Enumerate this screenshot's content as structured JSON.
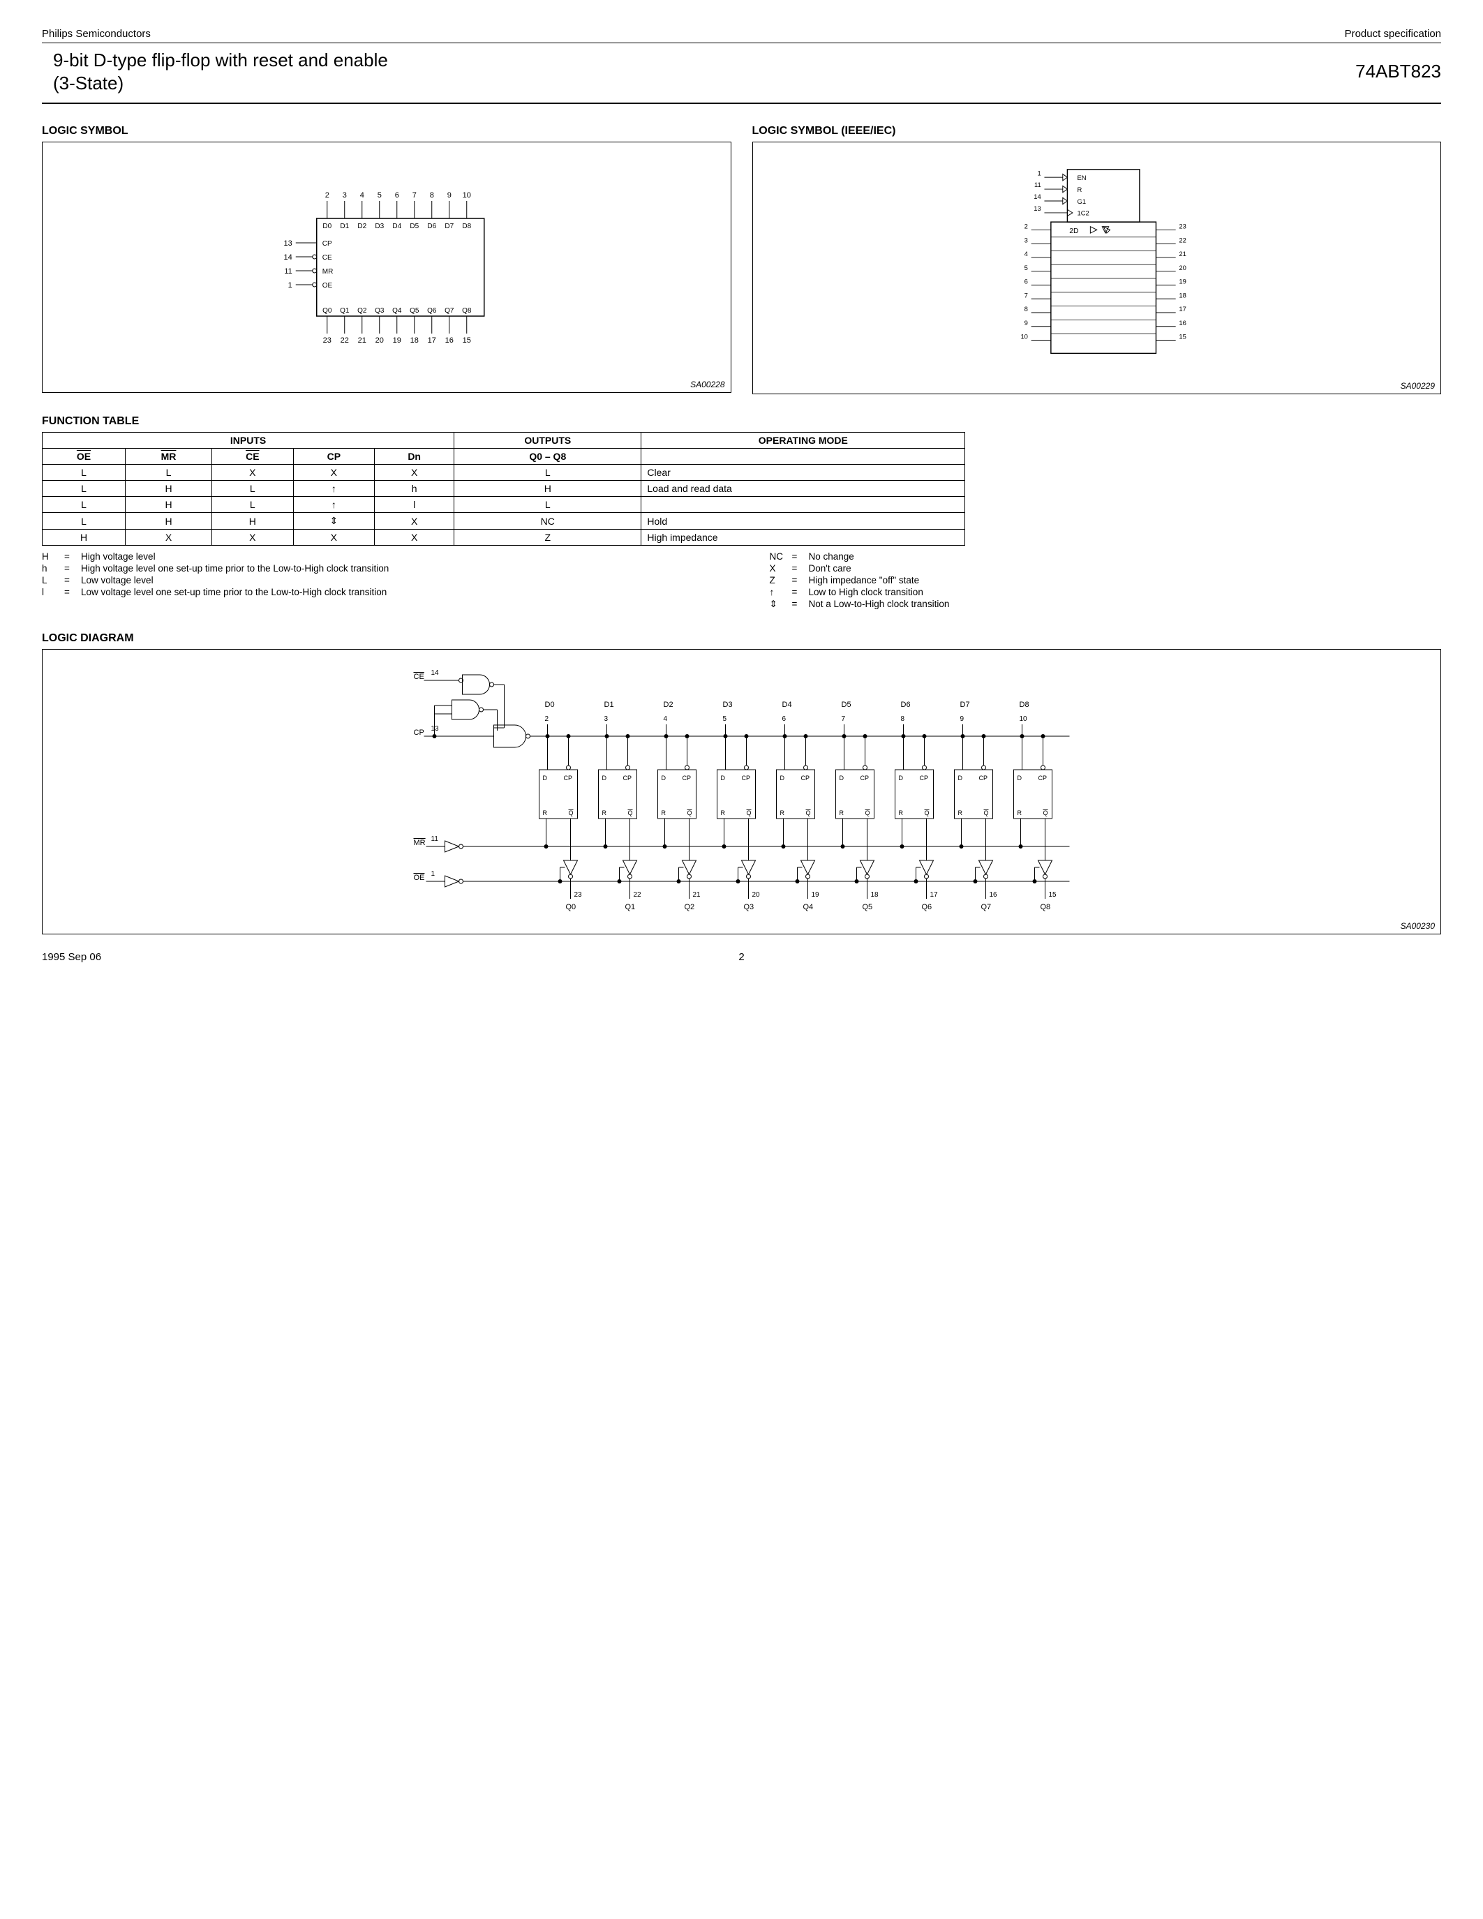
{
  "header": {
    "vendor": "Philips Semiconductors",
    "doc_type": "Product specification",
    "title_l1": "9-bit D-type flip-flop with reset and enable",
    "title_l2": "(3-State)",
    "part": "74ABT823"
  },
  "sections": {
    "logic_symbol": "LOGIC SYMBOL",
    "logic_symbol_ieee": "LOGIC SYMBOL (IEEE/IEC)",
    "function_table": "FUNCTION TABLE",
    "logic_diagram": "LOGIC DIAGRAM"
  },
  "figures": {
    "sym": "SA00228",
    "ieee": "SA00229",
    "diagram": "SA00230"
  },
  "logic_symbol": {
    "top_pins": [
      "2",
      "3",
      "4",
      "5",
      "6",
      "7",
      "8",
      "9",
      "10"
    ],
    "top_labels": [
      "D0",
      "D1",
      "D2",
      "D3",
      "D4",
      "D5",
      "D6",
      "D7",
      "D8"
    ],
    "left_pins": [
      "13",
      "14",
      "11",
      "1"
    ],
    "left_labels": [
      "CP",
      "CE",
      "MR",
      "OE"
    ],
    "bottom_labels": [
      "Q0",
      "Q1",
      "Q2",
      "Q3",
      "Q4",
      "Q5",
      "Q6",
      "Q7",
      "Q8"
    ],
    "bottom_pins": [
      "23",
      "22",
      "21",
      "20",
      "19",
      "18",
      "17",
      "16",
      "15"
    ]
  },
  "ieee_symbol": {
    "ctrl_pins": [
      "1",
      "11",
      "14",
      "13"
    ],
    "ctrl_labels": [
      "EN",
      "R",
      "G1",
      "1C2"
    ],
    "data_left": [
      "2",
      "3",
      "4",
      "5",
      "6",
      "7",
      "8",
      "9",
      "10"
    ],
    "data_right": [
      "23",
      "22",
      "21",
      "20",
      "19",
      "18",
      "17",
      "16",
      "15"
    ],
    "d_label": "2D"
  },
  "function_table": {
    "head_groups": [
      "INPUTS",
      "OUTPUTS",
      "OPERATING MODE"
    ],
    "cols": [
      "OE",
      "MR",
      "CE",
      "CP",
      "Dn",
      "Q0 – Q8"
    ],
    "rows": [
      {
        "c": [
          "L",
          "L",
          "X",
          "X",
          "X",
          "L"
        ],
        "mode": "Clear"
      },
      {
        "c": [
          "L",
          "H",
          "L",
          "↑",
          "h",
          "H"
        ],
        "mode": "Load and read data"
      },
      {
        "c": [
          "L",
          "H",
          "L",
          "↑",
          "l",
          "L"
        ],
        "mode": ""
      },
      {
        "c": [
          "L",
          "H",
          "H",
          "⇕",
          "X",
          "NC"
        ],
        "mode": "Hold"
      },
      {
        "c": [
          "H",
          "X",
          "X",
          "X",
          "X",
          "Z"
        ],
        "mode": "High impedance"
      }
    ]
  },
  "legend": {
    "left": [
      {
        "s": "H",
        "d": "High voltage level"
      },
      {
        "s": "h",
        "d": "High voltage level one set-up time prior to the Low-to-High clock transition"
      },
      {
        "s": "L",
        "d": "Low voltage level"
      },
      {
        "s": "l",
        "d": "Low voltage level one set-up time prior to the Low-to-High clock transition"
      }
    ],
    "right": [
      {
        "s": "NC",
        "d": "No change"
      },
      {
        "s": "X",
        "d": "Don't care"
      },
      {
        "s": "Z",
        "d": "High impedance \"off\" state"
      },
      {
        "s": "↑",
        "d": "Low to High clock transition"
      },
      {
        "s": "⇕",
        "d": "Not a Low-to-High clock transition"
      }
    ]
  },
  "logic_diagram": {
    "inputs": {
      "ce": "CE",
      "ce_pin": "14",
      "cp": "CP",
      "cp_pin": "13",
      "mr": "MR",
      "mr_pin": "11",
      "oe": "OE",
      "oe_pin": "1"
    },
    "d_labels": [
      "D0",
      "D1",
      "D2",
      "D3",
      "D4",
      "D5",
      "D6",
      "D7",
      "D8"
    ],
    "d_pins": [
      "2",
      "3",
      "4",
      "5",
      "6",
      "7",
      "8",
      "9",
      "10"
    ],
    "q_labels": [
      "Q0",
      "Q1",
      "Q2",
      "Q3",
      "Q4",
      "Q5",
      "Q6",
      "Q7",
      "Q8"
    ],
    "q_pins": [
      "23",
      "22",
      "21",
      "20",
      "19",
      "18",
      "17",
      "16",
      "15"
    ],
    "ff_labels": {
      "d": "D",
      "cp": "CP",
      "r": "R",
      "q": "Q"
    }
  },
  "footer": {
    "date": "1995 Sep 06",
    "page": "2"
  }
}
